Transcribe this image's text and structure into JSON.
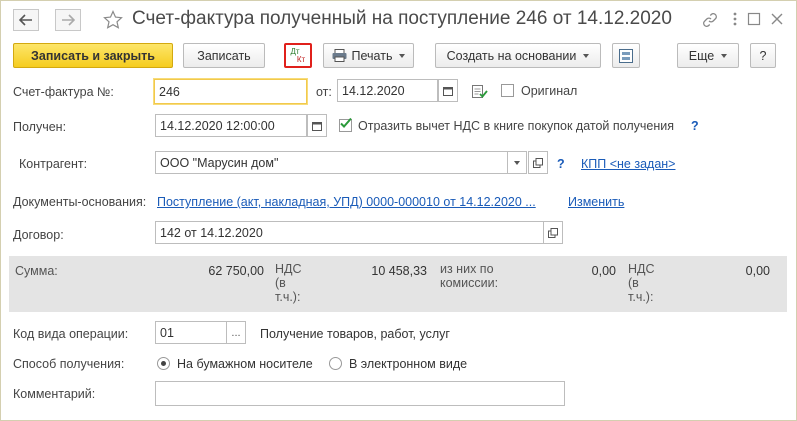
{
  "window": {
    "title": "Счет-фактура полученный на поступление 246 от 14.12.2020",
    "back_icon": "arrow-left-icon",
    "forward_icon": "arrow-right-icon",
    "star_icon": "star-icon",
    "link_icon": "link-icon",
    "menu_icon": "more-vertical-icon",
    "maximize_icon": "maximize-icon",
    "close_icon": "close-icon"
  },
  "toolbar": {
    "save_close": "Записать и закрыть",
    "save": "Записать",
    "dtkt_top": "Дт",
    "dtkt_bottom": "Кт",
    "print": "Печать",
    "create_based": "Создать на основании",
    "more": "Еще",
    "help": "?"
  },
  "form": {
    "invoice_label": "Счет-фактура №:",
    "invoice_number": "246",
    "from_label": "от:",
    "invoice_date": "14.12.2020",
    "original_label": "Оригинал",
    "received_label": "Получен:",
    "received_datetime": "14.12.2020 12:00:00",
    "vat_checkbox_label": "Отразить вычет НДС в книге покупок датой получения",
    "vat_help": "?",
    "counterparty_label": "Контрагент:",
    "counterparty_value": "ООО \"Марусин дом\"",
    "counterparty_help": "?",
    "kpp_link": "КПП <не задан>",
    "docs_label": "Документы-основания:",
    "docs_link": "Поступление (акт, накладная, УПД) 0000-000010 от 14.12.2020 ...",
    "docs_change": "Изменить",
    "contract_label": "Договор:",
    "contract_value": "142 от 14.12.2020",
    "op_code_label": "Код вида операции:",
    "op_code_value": "01",
    "op_code_btn": "...",
    "op_code_desc": "Получение товаров, работ, услуг",
    "method_label": "Способ получения:",
    "method_paper": "На бумажном носителе",
    "method_electronic": "В электронном виде",
    "comment_label": "Комментарий:",
    "comment_value": ""
  },
  "totals": {
    "sum_label": "Сумма:",
    "sum_value": "62 750,00",
    "vat_label_l1": "НДС",
    "vat_label_l2": "(в",
    "vat_label_l3": "т.ч.):",
    "vat_value": "10 458,33",
    "commission_l1": "из них по",
    "commission_l2": "комиссии:",
    "commission_value": "0,00",
    "vat2_label_l1": "НДС",
    "vat2_label_l2": "(в",
    "vat2_label_l3": "т.ч.):",
    "vat2_value": "0,00"
  }
}
